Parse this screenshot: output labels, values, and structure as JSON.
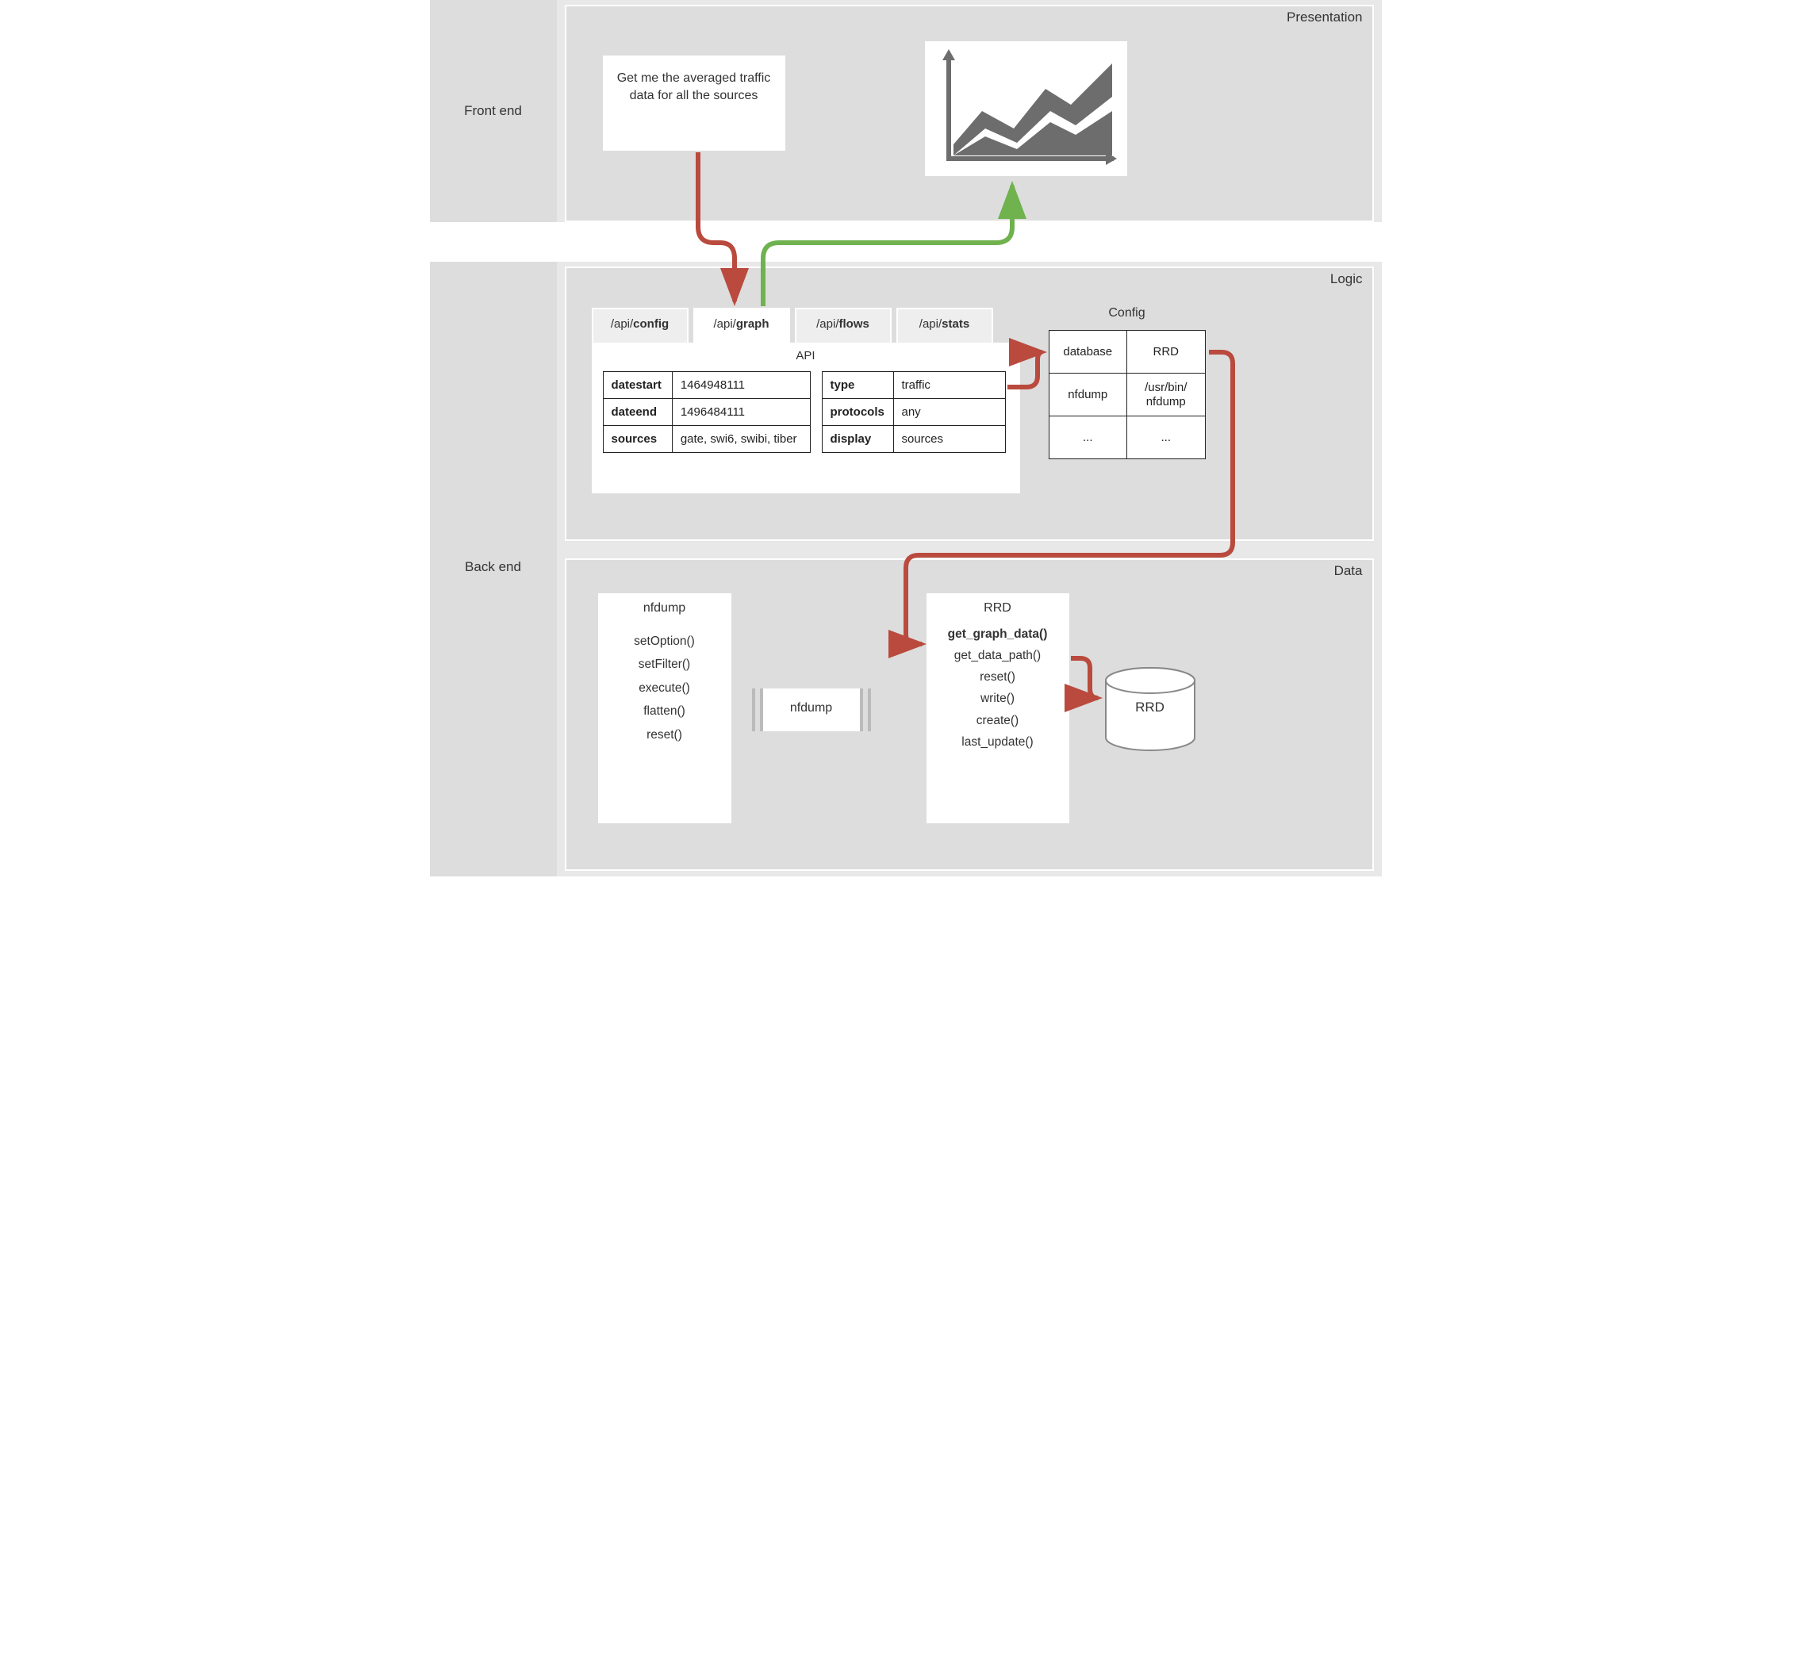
{
  "rows": {
    "frontend": "Front end",
    "backend": "Back end"
  },
  "layers": {
    "presentation": "Presentation",
    "logic": "Logic",
    "data": "Data"
  },
  "request_text": "Get me the averaged traffic data for all the sources",
  "tabs": {
    "config": {
      "prefix": "/api/",
      "name": "config"
    },
    "graph": {
      "prefix": "/api/",
      "name": "graph"
    },
    "flows": {
      "prefix": "/api/",
      "name": "flows"
    },
    "stats": {
      "prefix": "/api/",
      "name": "stats"
    }
  },
  "api_title": "API",
  "api_left": [
    {
      "k": "datestart",
      "v": "1464948111"
    },
    {
      "k": "dateend",
      "v": "1496484111"
    },
    {
      "k": "sources",
      "v": "gate, swi6, swibi, tiber"
    }
  ],
  "api_right": [
    {
      "k": "type",
      "v": "traffic"
    },
    {
      "k": "protocols",
      "v": "any"
    },
    {
      "k": "display",
      "v": "sources"
    }
  ],
  "config": {
    "title": "Config",
    "rows": [
      {
        "k": "database",
        "v": "RRD"
      },
      {
        "k": "nfdump",
        "v": "/usr/bin/\nnfdump"
      },
      {
        "k": "...",
        "v": "..."
      }
    ]
  },
  "data_layer": {
    "nfdump_box": {
      "title": "nfdump",
      "methods": [
        "setOption()",
        "setFilter()",
        "execute()",
        "flatten()",
        "reset()"
      ]
    },
    "nfdump_bin": "nfdump",
    "rrd_box": {
      "title": "RRD",
      "methods": [
        "get_graph_data()",
        "get_data_path()",
        "reset()",
        "write()",
        "create()",
        "last_update()"
      ],
      "bold_index": 0
    },
    "rrd_db": "RRD"
  },
  "colors": {
    "red": "#b94a3d",
    "green": "#6fb24e",
    "grey": "#6d6d6d"
  }
}
